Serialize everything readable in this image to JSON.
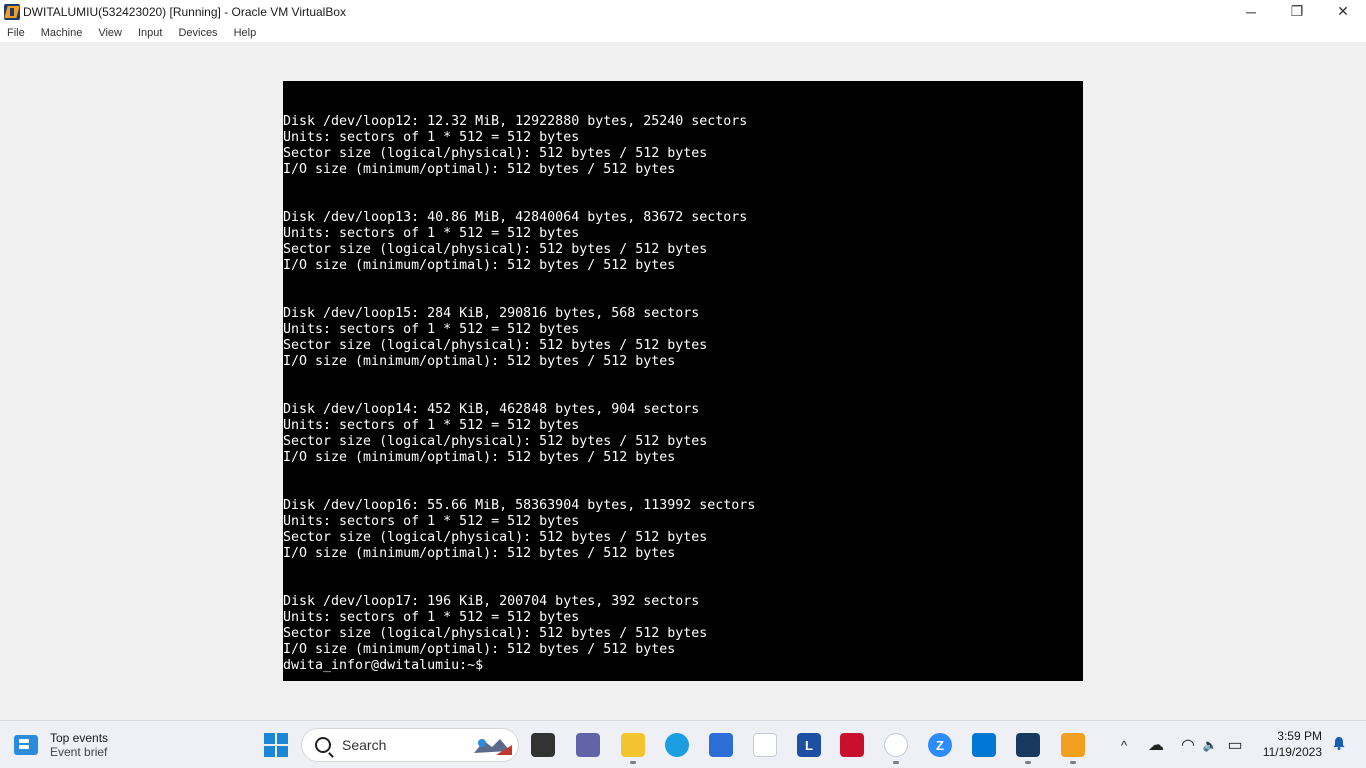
{
  "window": {
    "title": "DWITALUMIU(532423020) [Running] - Oracle VM VirtualBox",
    "minimize_glyph": "─",
    "restore_glyph": "❐",
    "close_glyph": "✕"
  },
  "menu": [
    "File",
    "Machine",
    "View",
    "Input",
    "Devices",
    "Help"
  ],
  "terminal": {
    "lines": [
      "Disk /dev/loop12: 12.32 MiB, 12922880 bytes, 25240 sectors",
      "Units: sectors of 1 * 512 = 512 bytes",
      "Sector size (logical/physical): 512 bytes / 512 bytes",
      "I/O size (minimum/optimal): 512 bytes / 512 bytes",
      "",
      "",
      "Disk /dev/loop13: 40.86 MiB, 42840064 bytes, 83672 sectors",
      "Units: sectors of 1 * 512 = 512 bytes",
      "Sector size (logical/physical): 512 bytes / 512 bytes",
      "I/O size (minimum/optimal): 512 bytes / 512 bytes",
      "",
      "",
      "Disk /dev/loop15: 284 KiB, 290816 bytes, 568 sectors",
      "Units: sectors of 1 * 512 = 512 bytes",
      "Sector size (logical/physical): 512 bytes / 512 bytes",
      "I/O size (minimum/optimal): 512 bytes / 512 bytes",
      "",
      "",
      "Disk /dev/loop14: 452 KiB, 462848 bytes, 904 sectors",
      "Units: sectors of 1 * 512 = 512 bytes",
      "Sector size (logical/physical): 512 bytes / 512 bytes",
      "I/O size (minimum/optimal): 512 bytes / 512 bytes",
      "",
      "",
      "Disk /dev/loop16: 55.66 MiB, 58363904 bytes, 113992 sectors",
      "Units: sectors of 1 * 512 = 512 bytes",
      "Sector size (logical/physical): 512 bytes / 512 bytes",
      "I/O size (minimum/optimal): 512 bytes / 512 bytes",
      "",
      "",
      "Disk /dev/loop17: 196 KiB, 200704 bytes, 392 sectors",
      "Units: sectors of 1 * 512 = 512 bytes",
      "Sector size (logical/physical): 512 bytes / 512 bytes",
      "I/O size (minimum/optimal): 512 bytes / 512 bytes",
      "dwita_infor@dwitalumiu:~$"
    ]
  },
  "taskbar": {
    "widget": {
      "title": "Top events",
      "subtitle": "Event brief"
    },
    "search_label": "Search",
    "icons": [
      {
        "name": "task-view-icon",
        "color": "#333333",
        "glyph": ""
      },
      {
        "name": "teams-chat-icon",
        "color": "#6264a7",
        "glyph": ""
      },
      {
        "name": "file-explorer-icon",
        "color": "#f4c430",
        "glyph": ""
      },
      {
        "name": "edge-browser-icon",
        "color": "#1b9de2",
        "glyph": ""
      },
      {
        "name": "microsoft-store-icon",
        "color": "#2b6fd6",
        "glyph": ""
      },
      {
        "name": "dropbox-icon",
        "color": "#ffffff",
        "glyph": ""
      },
      {
        "name": "l-app-icon",
        "color": "#1d4fa3",
        "glyph": "L"
      },
      {
        "name": "mcafee-icon",
        "color": "#c8102e",
        "glyph": ""
      },
      {
        "name": "chrome-icon",
        "color": "#ffffff",
        "glyph": ""
      },
      {
        "name": "zoom-icon",
        "color": "#2d8cff",
        "glyph": "Z"
      },
      {
        "name": "vscode-icon",
        "color": "#0078d4",
        "glyph": ""
      },
      {
        "name": "virtualbox-icon",
        "color": "#183a61",
        "glyph": ""
      },
      {
        "name": "virtualbox-vm-icon",
        "color": "#f2a01e",
        "glyph": ""
      }
    ],
    "tray": {
      "chevron_glyph": "^",
      "cloud_glyph": "☁",
      "wifi_glyph": "◠",
      "volume_glyph": "🔈",
      "battery_glyph": "▭"
    },
    "clock": {
      "time": "3:59 PM",
      "date": "11/19/2023"
    }
  }
}
